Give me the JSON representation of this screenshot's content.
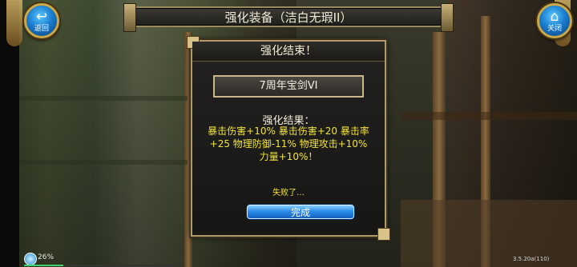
{
  "header": {
    "title": "强化装备（洁白无瑕II）",
    "back_icon": "↩",
    "back_label": "返回",
    "close_icon": "⌂",
    "close_label": "关闭"
  },
  "dialog": {
    "title": "强化结束！",
    "item_name": "7周年宝剑VI",
    "result_heading": "强化结果：",
    "result_lines": "暴击伤害+10% 暴击伤害+20 暴击率+25 物理防御-11% 物理攻击+10% 力量+10%！",
    "fail_text": "失败了…",
    "done_button": "完成"
  },
  "status": {
    "battery_pct": "26%",
    "loading_progress": 0.26,
    "version": "3.5.20a(110)"
  },
  "colors": {
    "accent_blue": "#2c8ee8",
    "result_yellow": "#f2e23a",
    "frame_gold": "#b09a68"
  }
}
